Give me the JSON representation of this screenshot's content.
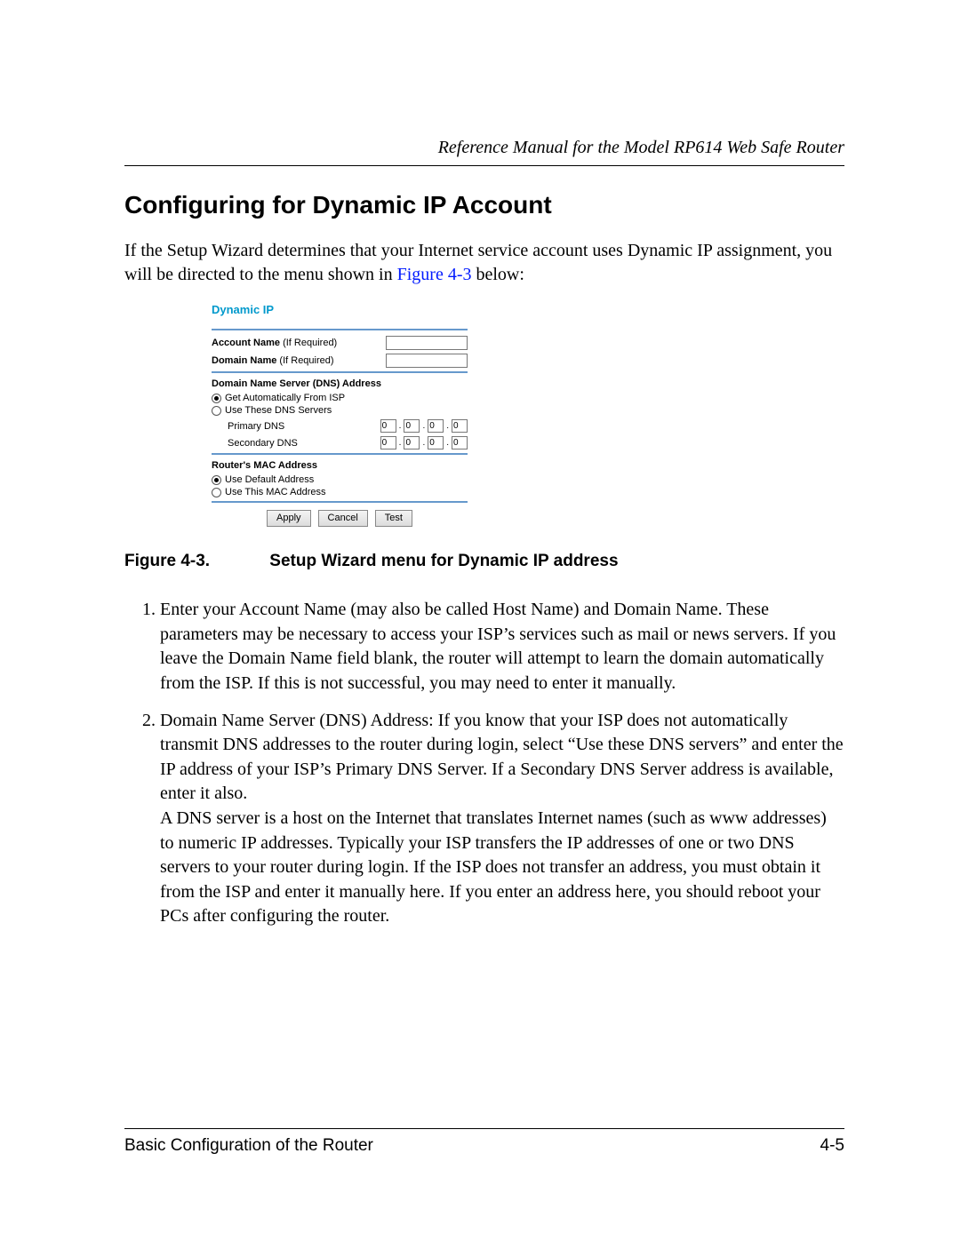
{
  "header": {
    "running_title": "Reference Manual for the Model RP614 Web Safe Router"
  },
  "section": {
    "title": "Configuring for Dynamic IP Account",
    "intro_before_link": "If the Setup Wizard determines that your Internet service account uses Dynamic IP assignment, you will be directed to the menu shown in ",
    "intro_link_text": "Figure 4-3",
    "intro_after_link": " below:"
  },
  "figure": {
    "caption_number": "Figure 4-3.",
    "caption_text": "Setup Wizard menu for Dynamic IP address",
    "ui": {
      "title": "Dynamic IP",
      "account_name_label_bold": "Account Name",
      "account_name_label_note": " (If Required)",
      "domain_name_label_bold": "Domain Name",
      "domain_name_label_note": " (If Required)",
      "account_name_value": "",
      "domain_name_value": "",
      "dns_heading": "Domain Name Server (DNS) Address",
      "dns_option_auto": "Get Automatically From ISP",
      "dns_option_manual": "Use These DNS Servers",
      "dns_selected": "auto",
      "primary_dns_label": "Primary DNS",
      "secondary_dns_label": "Secondary DNS",
      "primary_dns": [
        "0",
        "0",
        "0",
        "0"
      ],
      "secondary_dns": [
        "0",
        "0",
        "0",
        "0"
      ],
      "mac_heading": "Router's MAC Address",
      "mac_option_default": "Use Default Address",
      "mac_option_manual": "Use This MAC Address",
      "mac_selected": "default",
      "buttons": {
        "apply": "Apply",
        "cancel": "Cancel",
        "test": "Test"
      }
    }
  },
  "steps": {
    "item1": "Enter your Account Name (may also be called Host Name) and Domain Name. These parameters may be necessary to access your ISP’s services such as mail or news servers. If you leave the Domain Name field blank, the router will attempt to learn the domain automatically from the ISP. If this is not successful, you may need to enter it manually.",
    "item2": "Domain Name Server (DNS) Address: If you know that your ISP does not automatically transmit DNS addresses to the router during login, select “Use these DNS servers” and enter the IP address of your ISP’s Primary DNS Server. If a Secondary DNS Server address is available, enter it also.",
    "item2_sub": "A DNS server is a host on the Internet that translates Internet names (such as www addresses) to numeric IP addresses. Typically your ISP transfers the IP addresses of one or two DNS servers to your router during login. If the ISP does not transfer an address, you must obtain it from the ISP and enter it manually here. If you enter an address here, you should reboot your PCs after configuring the router."
  },
  "footer": {
    "section_name": "Basic Configuration of the Router",
    "page_number": "4-5"
  }
}
